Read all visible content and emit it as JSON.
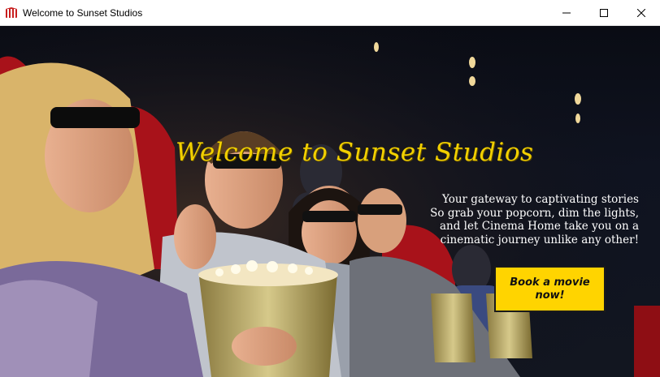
{
  "window": {
    "title": "Welcome to Sunset Studios",
    "icon": "film-reel-icon",
    "controls": [
      "minimize-icon",
      "maximize-icon",
      "close-icon"
    ]
  },
  "hero": {
    "headline": "Welcome to Sunset Studios",
    "tagline_lines": [
      "Your gateway to captivating stories",
      "So grab your popcorn, dim the lights,",
      "and let Cinema Home take you on a",
      "cinematic journey unlike any other!"
    ],
    "cta_label": "Book a movie now!"
  },
  "colors": {
    "accent": "#ffd400",
    "headline": "#f2d000",
    "cta_border": "#1a1a1a",
    "seat_red": "#b3141c"
  }
}
